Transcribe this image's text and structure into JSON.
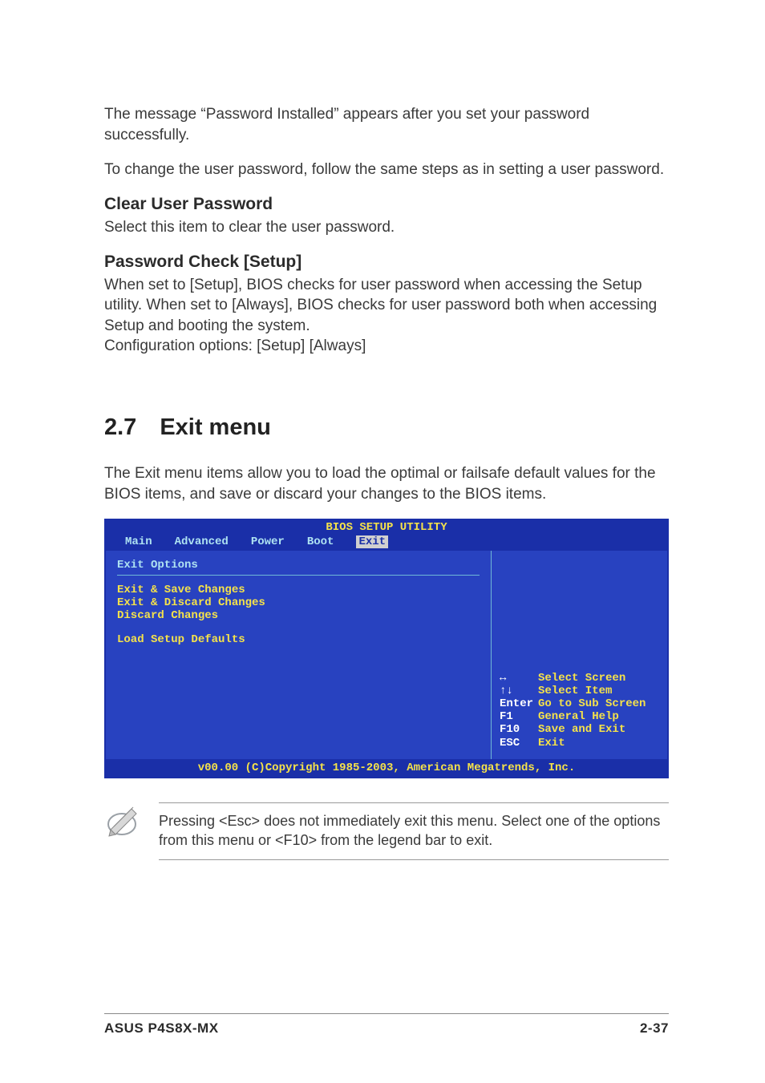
{
  "paragraphs": {
    "p1": "The message “Password Installed” appears after you set your password successfully.",
    "p2": "To change the user password, follow the same steps as in setting a user password."
  },
  "sections": {
    "clear_user_password": {
      "heading": "Clear User Password",
      "body": "Select this item to clear the user password."
    },
    "password_check": {
      "heading": "Password Check [Setup]",
      "body1": "When set to [Setup], BIOS checks for user password when accessing the Setup utility. When set to [Always], BIOS checks for user password both when accessing Setup and booting the system.",
      "body2": "Configuration options: [Setup] [Always]"
    },
    "exit_menu": {
      "heading": "2.7 Exit menu",
      "intro": "The Exit menu items allow you to load the optimal or failsafe default values for the BIOS items, and save or discard your changes to the BIOS items."
    }
  },
  "bios": {
    "title": "BIOS SETUP UTILITY",
    "tabs": {
      "main": "Main",
      "advanced": "Advanced",
      "power": "Power",
      "boot": "Boot",
      "exit": "Exit"
    },
    "left": {
      "section_label": "Exit Options",
      "items": {
        "save": "Exit & Save Changes",
        "discard_exit": "Exit & Discard Changes",
        "discard": "Discard Changes",
        "defaults": "Load Setup Defaults"
      }
    },
    "help": {
      "r1": {
        "key": "↔",
        "label": "Select Screen"
      },
      "r2": {
        "key": "↑↓",
        "label": "Select Item"
      },
      "r3": {
        "key": "Enter",
        "label": "Go to Sub Screen"
      },
      "r4": {
        "key": "F1",
        "label": "General Help"
      },
      "r5": {
        "key": "F10",
        "label": "Save and Exit"
      },
      "r6": {
        "key": "ESC",
        "label": "Exit"
      }
    },
    "copyright": "v00.00 (C)Copyright 1985-2003, American Megatrends, Inc."
  },
  "note": "Pressing <Esc> does not immediately exit this menu. Select one of the options from this menu or <F10> from the legend bar to exit.",
  "footer": {
    "left": "ASUS P4S8X-MX",
    "right": "2-37"
  }
}
